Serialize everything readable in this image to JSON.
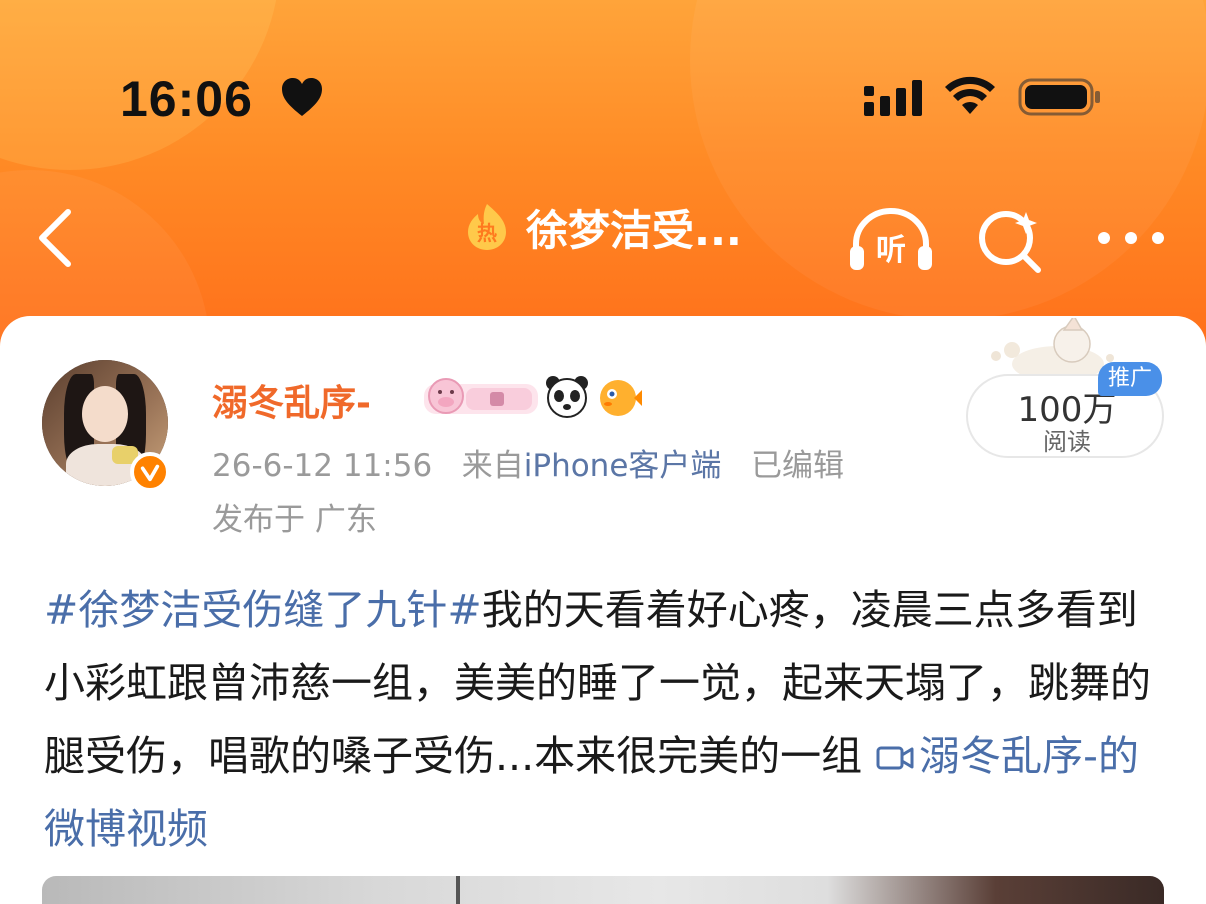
{
  "status_bar": {
    "time": "16:06",
    "heart_icon": "heart-icon",
    "signal_icon": "cellular-signal-icon",
    "wifi_icon": "wifi-icon",
    "battery_icon": "battery-icon"
  },
  "nav": {
    "back_icon": "chevron-left-icon",
    "hot_badge": "热",
    "title": "徐梦洁受...",
    "listen_label": "听",
    "search_icon": "search-sparkle-icon",
    "more_icon": "more-dots-icon"
  },
  "post": {
    "author": "溺冬乱序-",
    "verified": true,
    "timestamp": "26-6-12 11:56",
    "source_prefix": "来自",
    "source": "iPhone客户端",
    "edited": "已编辑",
    "location": "发布于 广东",
    "reads": {
      "count": "100万",
      "label": "阅读",
      "promo": "推广"
    },
    "hashtag": "#徐梦洁受伤缝了九针#",
    "body": "我的天看着好心疼，凌晨三点多看到小彩虹跟曾沛慈一组，美美的睡了一觉，起来天塌了，跳舞的腿受伤，唱歌的嗓子受伤...本来很完美的一组",
    "video_link": "溺冬乱序-的微博视频"
  },
  "colors": {
    "header_orange": "#ff7a1f",
    "username": "#f0692a",
    "link_blue": "#4a6ea9",
    "promo_blue": "#4a90e8",
    "meta_gray": "#9a9a9a"
  }
}
